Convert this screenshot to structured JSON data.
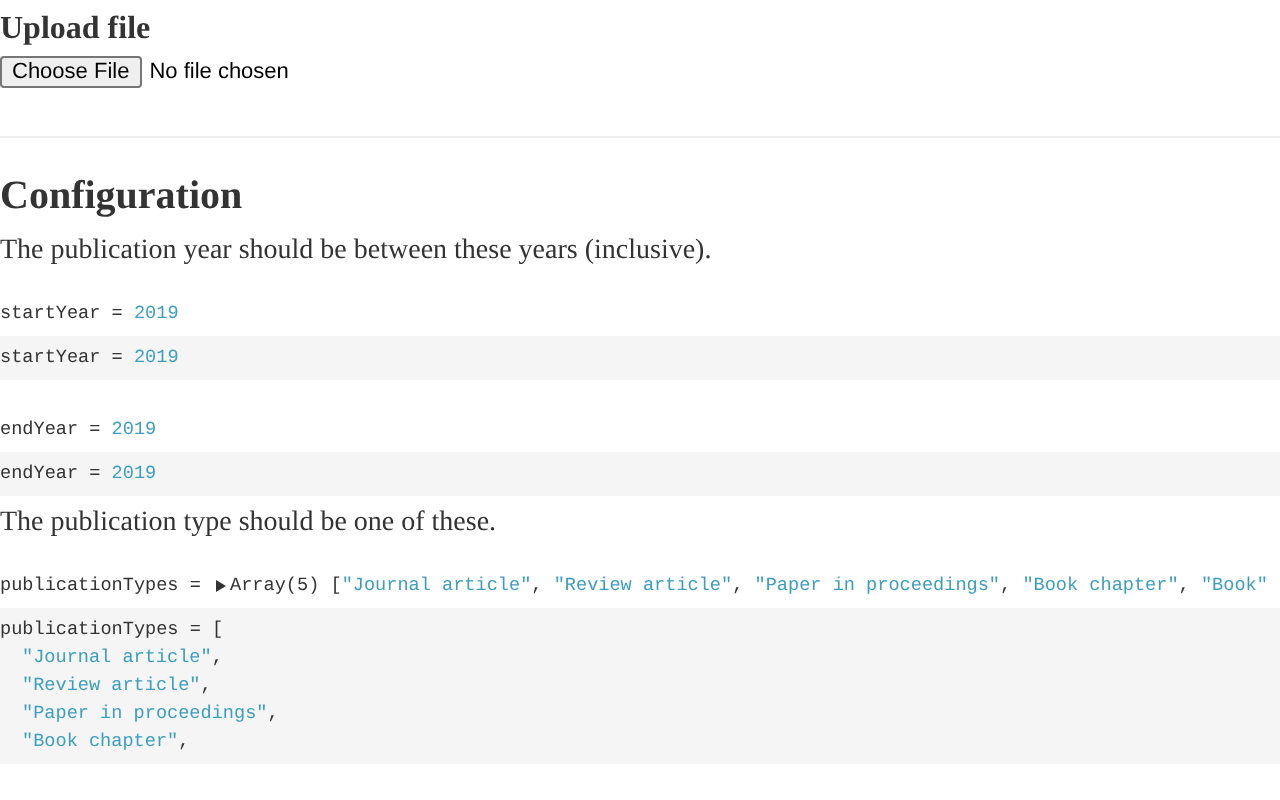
{
  "upload": {
    "title": "Upload file",
    "button": "Choose File",
    "status": "No file chosen"
  },
  "configuration": {
    "title": "Configuration",
    "blocks": [
      {
        "kind": "paragraph",
        "text": "The publication year should be between these years (inclusive)."
      },
      {
        "kind": "output",
        "name": "startYear",
        "operator": "=",
        "value": "2019"
      },
      {
        "kind": "source",
        "name": "startYear",
        "operator": "=",
        "value": "2019"
      },
      {
        "kind": "output",
        "name": "endYear",
        "operator": "=",
        "value": "2019"
      },
      {
        "kind": "source",
        "name": "endYear",
        "operator": "=",
        "value": "2019"
      },
      {
        "kind": "paragraph",
        "text": "The publication type should be one of these."
      },
      {
        "kind": "array-output",
        "name": "publicationTypes",
        "operator": "=",
        "summary": "Array(5)",
        "open": "[",
        "separator": ",",
        "expanded": false,
        "items": [
          "\"Journal article\"",
          "\"Review article\"",
          "\"Paper in proceedings\"",
          "\"Book chapter\"",
          "\"Book\""
        ]
      },
      {
        "kind": "array-source",
        "name": "publicationTypes",
        "operator": "=",
        "open": "[",
        "separator": ",",
        "items": [
          "\"Journal article\"",
          "\"Review article\"",
          "\"Paper in proceedings\"",
          "\"Book chapter\""
        ]
      }
    ]
  }
}
